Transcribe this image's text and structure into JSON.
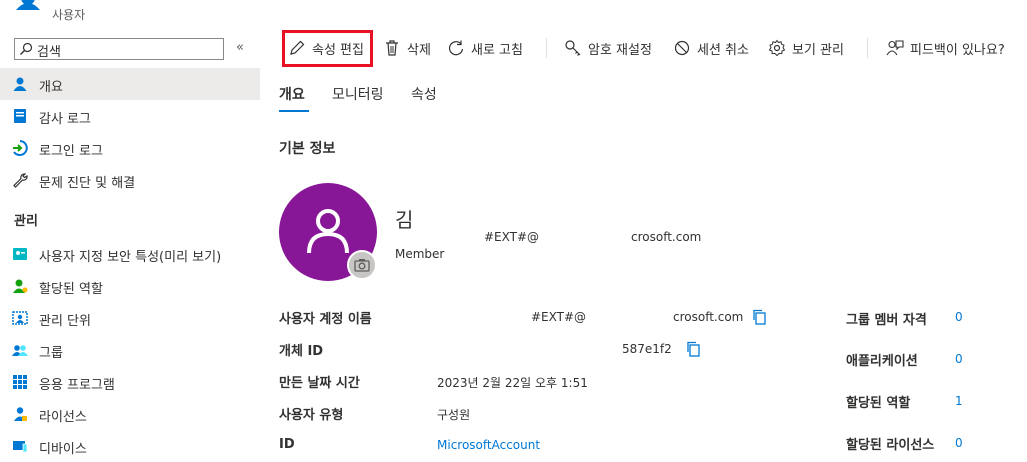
{
  "app": {
    "title": "사용자"
  },
  "sidebar": {
    "search_placeholder": "검색",
    "collapse": "«",
    "items_top": [
      {
        "label": "개요",
        "icon": "user-icon",
        "active": true
      },
      {
        "label": "감사 로그",
        "icon": "audit-log-icon"
      },
      {
        "label": "로그인 로그",
        "icon": "signin-log-icon"
      },
      {
        "label": "문제 진단 및 해결",
        "icon": "wrench-icon"
      }
    ],
    "section_manage": "관리",
    "items_manage": [
      {
        "label": "사용자 지정 보안 특성(미리 보기)",
        "icon": "security-attribute-icon"
      },
      {
        "label": "할당된 역할",
        "icon": "assigned-roles-icon"
      },
      {
        "label": "관리 단위",
        "icon": "admin-units-icon"
      },
      {
        "label": "그룹",
        "icon": "groups-icon"
      },
      {
        "label": "응용 프로그램",
        "icon": "apps-grid-icon"
      },
      {
        "label": "라이선스",
        "icon": "licenses-icon"
      },
      {
        "label": "디바이스",
        "icon": "devices-icon"
      }
    ]
  },
  "toolbar": {
    "edit_properties": "속성 편집",
    "delete": "삭제",
    "refresh": "새로 고침",
    "reset_password": "암호 재설정",
    "revoke_sessions": "세션 취소",
    "manage_view": "보기 관리",
    "feedback": "피드백이 있나요?"
  },
  "tabs": [
    "개요",
    "모니터링",
    "속성"
  ],
  "basic_info": "기본 정보",
  "profile": {
    "name": "김",
    "email_part1": "#EXT#@",
    "email_part2": "crosoft.com",
    "type": "Member"
  },
  "properties": [
    {
      "label": "사용자 계정 이름",
      "value1": "#EXT#@",
      "value2": "crosoft.com"
    },
    {
      "label": "개체 ID",
      "value2": "587e1f2"
    },
    {
      "label": "만든 날짜 시간",
      "value1": "2023년 2월 22일 오후 1:51"
    },
    {
      "label": "사용자 유형",
      "value1": "구성원"
    },
    {
      "label": "ID",
      "value1": "MicrosoftAccount"
    }
  ],
  "right_stats": [
    {
      "label": "그룹 멤버 자격",
      "value": "0"
    },
    {
      "label": "애플리케이션",
      "value": "0"
    },
    {
      "label": "할당된 역할",
      "value": "1"
    },
    {
      "label": "할당된 라이선스",
      "value": "0"
    }
  ],
  "colors": {
    "accent": "#0078d4",
    "avatar": "#881798",
    "highlight": "#e81123"
  }
}
